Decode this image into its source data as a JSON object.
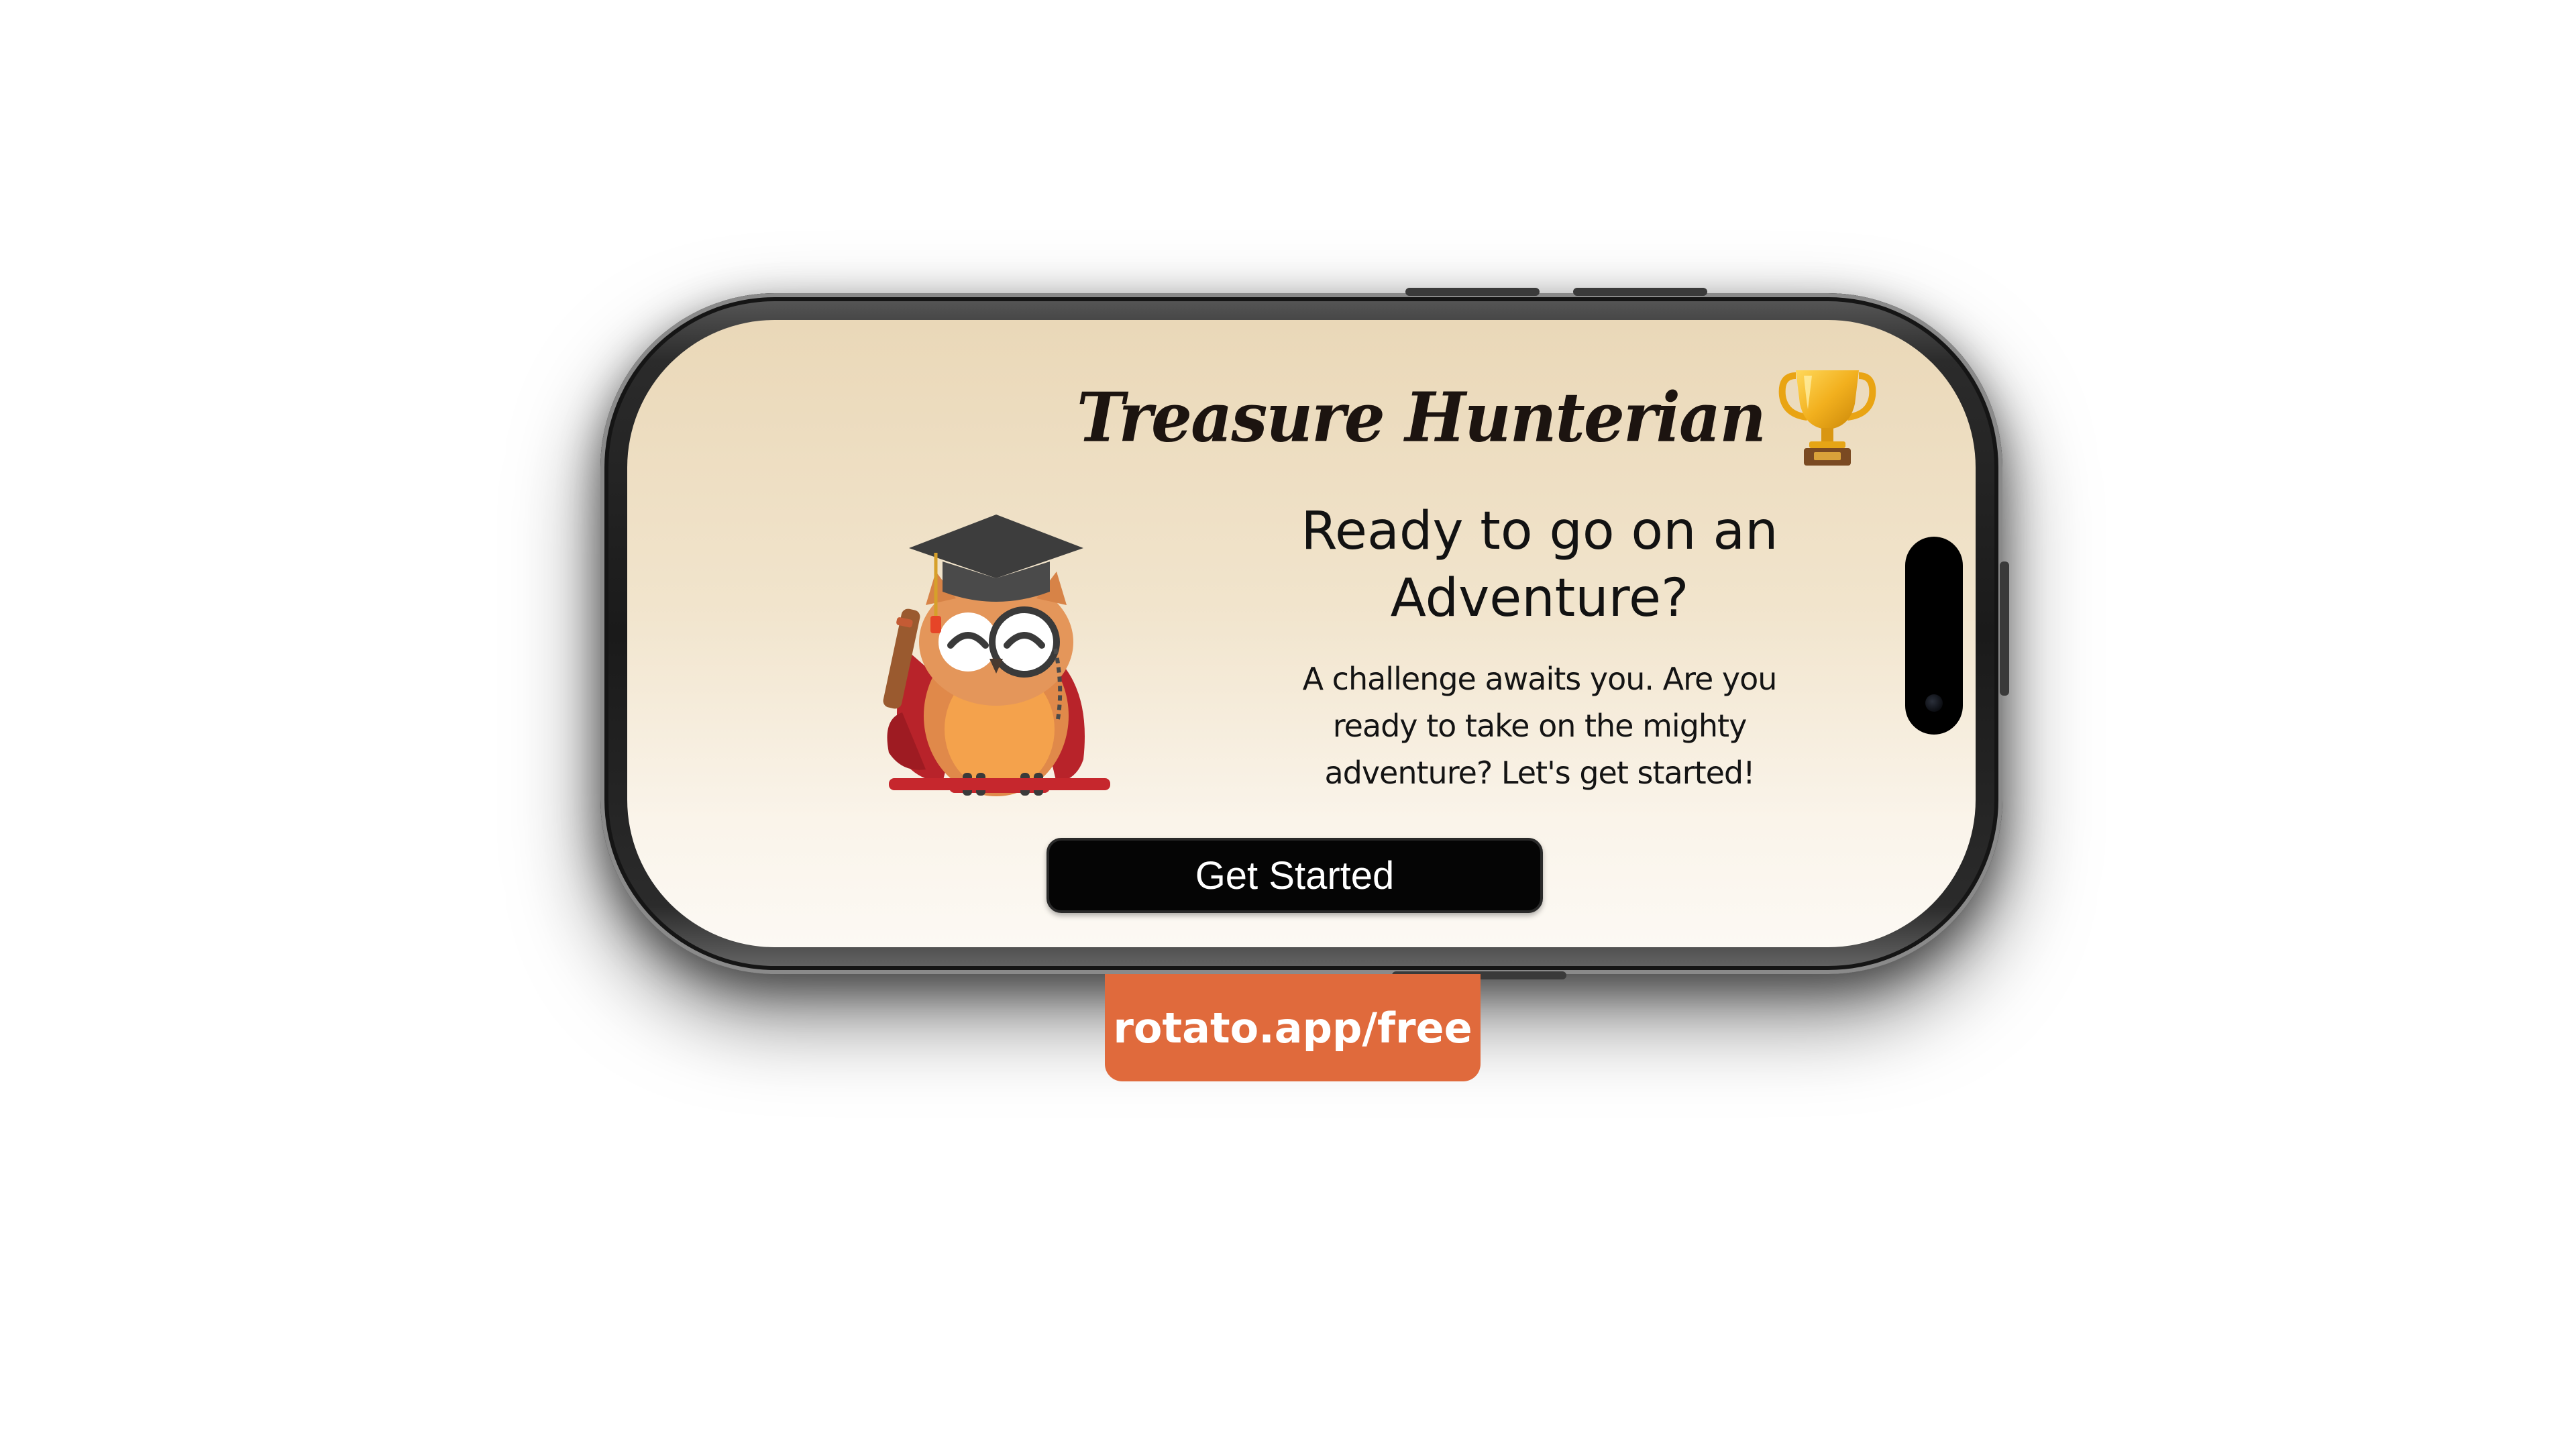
{
  "app": {
    "title": "Treasure Hunterian",
    "trophy_icon": "trophy-icon",
    "mascot_icon": "graduate-owl-icon"
  },
  "hero": {
    "headline_line1": "Ready to go on an",
    "headline_line2": "Adventure?",
    "body_line1": "A challenge awaits you. Are you",
    "body_line2": "ready to take on the mighty",
    "body_line3": "adventure? Let's get started!"
  },
  "cta": {
    "label": "Get Started"
  },
  "watermark": {
    "text": "rotato.app/free",
    "color": "#e06a3c"
  },
  "colors": {
    "screen_top": "#ead8b8",
    "screen_bottom": "#fcf9f4",
    "button_bg": "#050505",
    "button_text": "#ffffff"
  }
}
